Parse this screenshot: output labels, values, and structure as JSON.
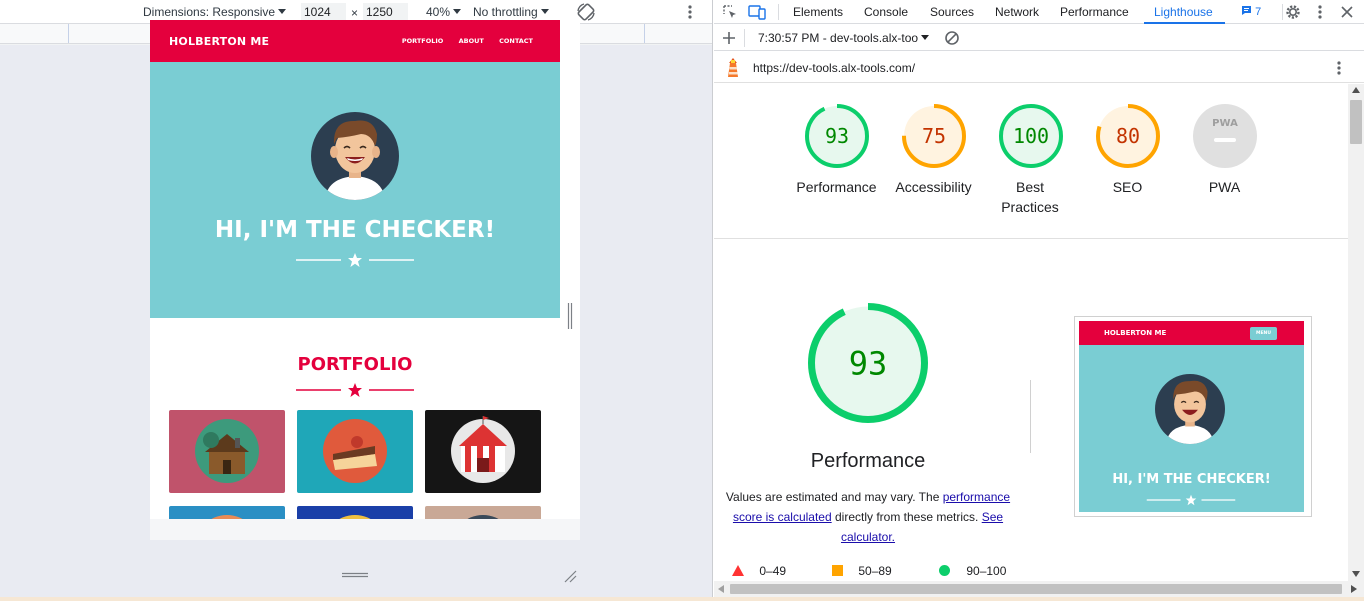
{
  "device_toolbar": {
    "dimensions_label": "Dimensions: Responsive",
    "width_value": "1024",
    "times": "×",
    "height_value": "1250",
    "zoom": "40%",
    "throttling": "No throttling"
  },
  "page_preview": {
    "logo": "HOLBERTON ME",
    "nav": [
      "PORTFOLIO",
      "ABOUT",
      "CONTACT"
    ],
    "hero_title": "HI, I'M THE CHECKER!",
    "section_title": "PORTFOLIO"
  },
  "devtools": {
    "tabs": [
      "Elements",
      "Console",
      "Sources",
      "Network",
      "Performance",
      "Lighthouse"
    ],
    "active_tab": "Lighthouse",
    "issues_count": "7",
    "report_selector": "7:30:57 PM - dev-tools.alx-too",
    "url": "https://dev-tools.alx-tools.com/"
  },
  "scores": [
    {
      "label": "Performance",
      "value": "93",
      "fraction": 0.93,
      "color": "#0cce6b",
      "text_color": "#008800",
      "bg": "#e7f8ee"
    },
    {
      "label": "Accessibility",
      "value": "75",
      "fraction": 0.75,
      "color": "#ffa400",
      "text_color": "#c33300",
      "bg": "#fff3e0"
    },
    {
      "label": "Best Practices",
      "value": "100",
      "fraction": 1.0,
      "color": "#0cce6b",
      "text_color": "#008800",
      "bg": "#e7f8ee"
    },
    {
      "label": "SEO",
      "value": "80",
      "fraction": 0.8,
      "color": "#ffa400",
      "text_color": "#c33300",
      "bg": "#fff3e0"
    },
    {
      "label": "PWA",
      "value": "",
      "fraction": 0,
      "color": "#d9d9d9",
      "text_color": "#9e9e9e",
      "bg": "#e0e0e0"
    }
  ],
  "pwa_badge_text": "PWA",
  "big_gauge": {
    "value": "93",
    "fraction": 0.93,
    "label": "Performance"
  },
  "description": {
    "text1": "Values are estimated and may vary. The ",
    "link1": "performance score is calculated",
    "text2": " directly from these metrics. ",
    "link2": "See calculator."
  },
  "legend": [
    {
      "shape": "triangle",
      "color": "#ff3333",
      "range": "0–49"
    },
    {
      "shape": "square",
      "color": "#ffa400",
      "range": "50–89"
    },
    {
      "shape": "circle",
      "color": "#0cce6b",
      "range": "90–100"
    }
  ],
  "screenshot": {
    "logo": "HOLBERTON ME",
    "menu": "MENU",
    "hero_title": "HI, I'M THE CHECKER!"
  }
}
